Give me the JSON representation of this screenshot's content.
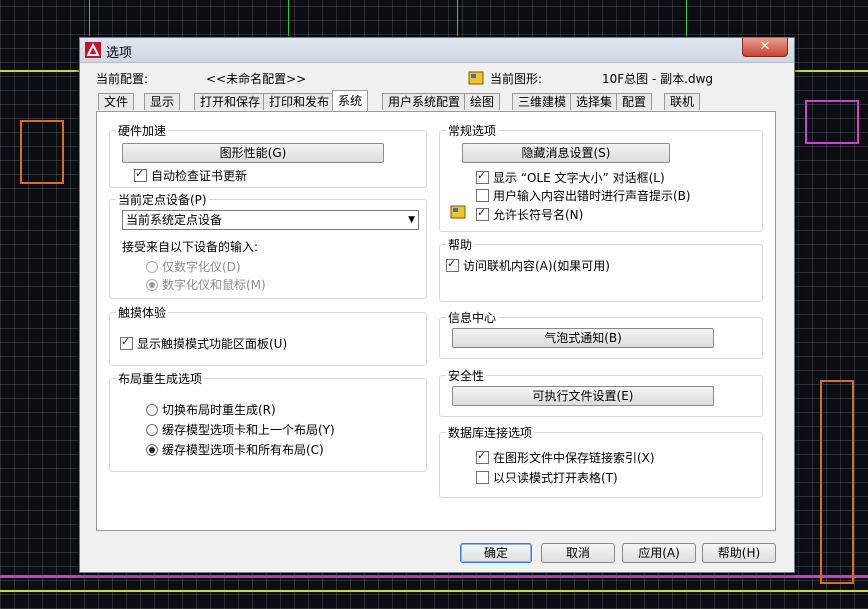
{
  "window": {
    "title": "选项",
    "close_label": "✕"
  },
  "profile": {
    "current_profile_label": "当前配置:",
    "current_profile_value": "<<未命名配置>>",
    "current_drawing_label": "当前图形:",
    "current_drawing_value": "10F总图 - 副本.dwg"
  },
  "tabs": [
    "文件",
    "显示",
    "打开和保存",
    "打印和发布",
    "系统",
    "用户系统配置",
    "绘图",
    "三维建模",
    "选择集",
    "配置",
    "联机"
  ],
  "active_tab": "系统",
  "hardware": {
    "title": "硬件加速",
    "graphics_button": "图形性能(G)",
    "auto_check": "自动检查证书更新"
  },
  "pointing": {
    "title": "当前定点设备(P)",
    "select_value": "当前系统定点设备",
    "accept_label": "接受来自以下设备的输入:",
    "opt_digitizer": "仅数字化仪(D)",
    "opt_digitizer_mouse": "数字化仪和鼠标(M)"
  },
  "touch": {
    "title": "触摸体验",
    "show_panel": "显示触摸模式功能区面板(U)"
  },
  "layout": {
    "title": "布局重生成选项",
    "opt1": "切换布局时重生成(R)",
    "opt2": "缓存模型选项卡和上一个布局(Y)",
    "opt3": "缓存模型选项卡和所有布局(C)"
  },
  "general": {
    "title": "常规选项",
    "hidden_msg_button": "隐藏消息设置(S)",
    "ole_text": "显示 “OLE 文字大小” 对话框(L)",
    "beep": "用户输入内容出错时进行声音提示(B)",
    "long_names": "允许长符号名(N)"
  },
  "help": {
    "title": "帮助",
    "online": "访问联机内容(A)(如果可用)"
  },
  "infocenter": {
    "title": "信息中心",
    "balloon_button": "气泡式通知(B)"
  },
  "security": {
    "title": "安全性",
    "exec_button": "可执行文件设置(E)"
  },
  "db": {
    "title": "数据库连接选项",
    "save_index": "在图形文件中保存链接索引(X)",
    "readonly": "以只读模式打开表格(T)"
  },
  "footer": {
    "ok": "确定",
    "cancel": "取消",
    "apply": "应用(A)",
    "help": "帮助(H)"
  }
}
